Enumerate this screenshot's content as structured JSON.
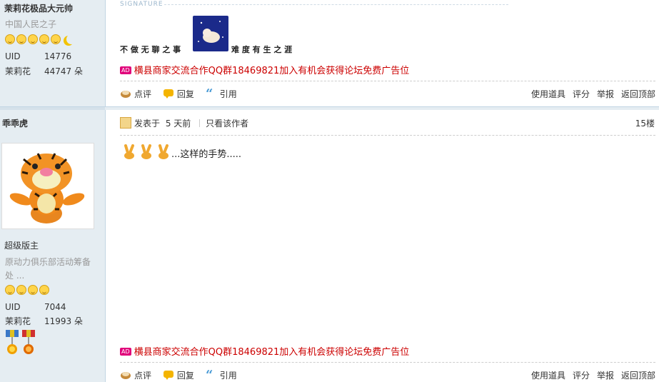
{
  "post1": {
    "author_name": "茉莉花极品大元帅",
    "author_title": "中国人民之子",
    "uid_label": "UID",
    "uid_value": "14776",
    "flower_label": "茉莉花",
    "flower_value": "44747 朵",
    "signature_label": "SIGNATURE",
    "signature_left": "不 做 无 聊 之 事",
    "signature_right": "难 度 有 生 之 涯",
    "ad_badge": "AD",
    "ad_text": "横县商家交流合作QQ群18469821加入有机会获得论坛免费广告位",
    "actions": {
      "comment": "点评",
      "reply": "回复",
      "quote": "引用",
      "use_tool": "使用道具",
      "rate": "评分",
      "report": "举报",
      "back_top": "返回顶部"
    }
  },
  "post2": {
    "author_name": "乖乖虎",
    "author_group": "超级版主",
    "author_desc_line1": "原动力俱乐部活动筹备",
    "author_desc_line2": "处 ...",
    "uid_label": "UID",
    "uid_value": "7044",
    "flower_label": "茉莉花",
    "flower_value": "11993 朵",
    "posted_label": "发表于",
    "posted_time": "5 天前",
    "only_author": "只看该作者",
    "floor": "15楼",
    "content_text": "...这样的手势.....",
    "ad_badge": "AD",
    "ad_text": "横县商家交流合作QQ群18469821加入有机会获得论坛免费广告位",
    "actions": {
      "comment": "点评",
      "reply": "回复",
      "quote": "引用",
      "use_tool": "使用道具",
      "rate": "评分",
      "report": "举报",
      "back_top": "返回顶部"
    }
  },
  "colors": {
    "sidebar_bg": "#e5edf2",
    "ad_link": "#cc0000",
    "ad_badge": "#e0007a"
  }
}
